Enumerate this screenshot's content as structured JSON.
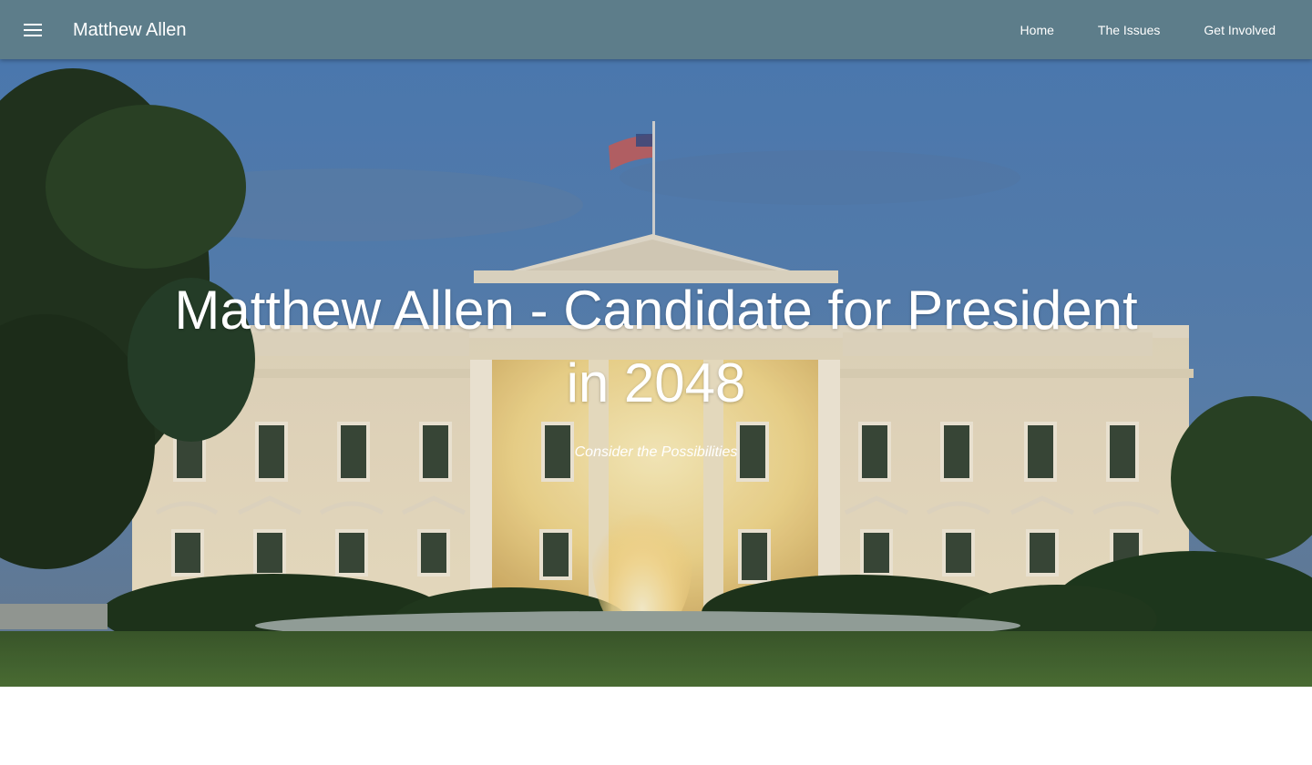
{
  "header": {
    "brand": "Matthew Allen",
    "menu_icon": "hamburger-menu-icon",
    "nav": [
      {
        "label": "Home"
      },
      {
        "label": "The Issues"
      },
      {
        "label": "Get Involved"
      }
    ]
  },
  "hero": {
    "title": "Matthew Allen - Candidate for President in 2048",
    "subtitle": "Consider the Possibilities",
    "background_image": "white-house-at-dusk-photo"
  },
  "colors": {
    "header_bg": "#5d7d8a",
    "text": "#ffffff"
  }
}
